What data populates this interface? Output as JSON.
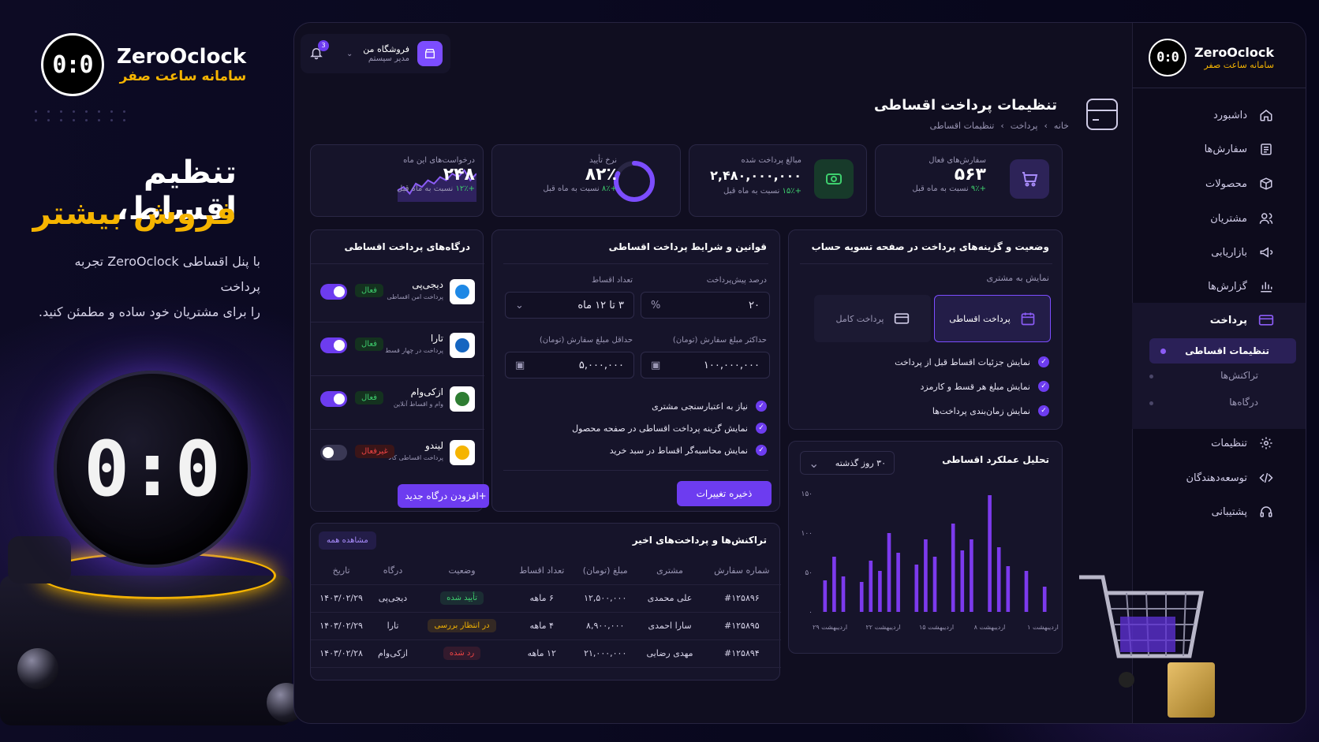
{
  "promo": {
    "brand_name": "ZeroOclock",
    "brand_sub": "سامانه ساعت صفر",
    "logo_text": "0:0",
    "hero_line1": "تنظیم اقساط،",
    "hero_line2": "فروش بیشتر",
    "desc_line1": "با پنل اقساطی ZeroOclock تجربه پرداخت",
    "desc_line2": "را برای مشتریان خود ساده و مطمئن کنید.",
    "coin_text": "0:0"
  },
  "topbar": {
    "notif_count": "3",
    "store_name": "فروشگاه من",
    "store_role": "مدیر سیستم"
  },
  "sidebar": {
    "brand_name": "ZeroOclock",
    "brand_sub": "سامانه ساعت صفر",
    "logo_text": "0:0",
    "items": [
      {
        "label": "داشبورد",
        "icon": "home-icon"
      },
      {
        "label": "سفارش‌ها",
        "icon": "orders-icon"
      },
      {
        "label": "محصولات",
        "icon": "box-icon"
      },
      {
        "label": "مشتریان",
        "icon": "users-icon"
      },
      {
        "label": "بازاریابی",
        "icon": "megaphone-icon"
      },
      {
        "label": "گزارش‌ها",
        "icon": "chart-icon"
      },
      {
        "label": "پرداخت",
        "icon": "card-icon"
      },
      {
        "label": "تنظیمات",
        "icon": "gear-icon"
      },
      {
        "label": "توسعه‌دهندگان",
        "icon": "code-icon"
      },
      {
        "label": "پشتیبانی",
        "icon": "headset-icon"
      }
    ],
    "sub_items": [
      "تنظیمات اقساطی",
      "تراکنش‌ها",
      "درگاه‌ها"
    ]
  },
  "header": {
    "title": "تنظیمات پرداخت اقساطی",
    "breadcrumb": [
      "خانه",
      "پرداخت",
      "تنظیمات اقساطی"
    ]
  },
  "stats": [
    {
      "label": "سفارش‌های فعال",
      "value": "۵۶۳",
      "delta": "+۹٪",
      "delta_label": "نسبت به ماه قبل"
    },
    {
      "label": "مبالغ پرداخت شده",
      "value": "۲,۴۸۰,۰۰۰,۰۰۰",
      "delta": "+۱۵٪",
      "delta_label": "نسبت به ماه قبل"
    },
    {
      "label": "نرخ تأیید",
      "value": "۸۲٪",
      "delta": "+۸٪",
      "delta_label": "نسبت به ماه قبل",
      "progress": 0.82
    },
    {
      "label": "درخواست‌های این ماه",
      "value": "۲۴۸",
      "delta": "+۱۲٪",
      "delta_label": "نسبت به ماه قبل",
      "spark": [
        3,
        4,
        2,
        5,
        4,
        6,
        5,
        7,
        6,
        8,
        7,
        9,
        6,
        8
      ]
    }
  ],
  "checkout": {
    "title": "وضعیت و گزینه‌های پرداخت در صفحه تسویه حساب",
    "show_label": "نمایش به مشتری",
    "option_installment": "پرداخت اقساطی",
    "option_full": "پرداخت کامل",
    "checks": [
      "نمایش جزئیات اقساط قبل از پرداخت",
      "نمایش مبلغ هر قسط و کارمزد",
      "نمایش زمان‌بندی پرداخت‌ها"
    ]
  },
  "rules": {
    "title": "قوانین و شرایط پرداخت اقساطی",
    "prepay_label": "درصد پیش‌پرداخت",
    "prepay_value": "۲۰",
    "prepay_unit": "%",
    "count_label": "تعداد اقساط",
    "count_value": "۳ تا ۱۲ ماه",
    "max_label": "حداکثر مبلغ سفارش (تومان)",
    "max_value": "۱۰۰,۰۰۰,۰۰۰",
    "min_label": "حداقل مبلغ سفارش (تومان)",
    "min_value": "۵,۰۰۰,۰۰۰",
    "checks": [
      "نیاز به اعتبارسنجی مشتری",
      "نمایش گزینه پرداخت اقساطی در صفحه محصول",
      "نمایش محاسبه‌گر اقساط در سبد خرید"
    ],
    "save_label": "ذخیره تغییرات"
  },
  "gateways": {
    "title": "درگاه‌های پرداخت اقساطی",
    "items": [
      {
        "name": "دیجی‌پی",
        "desc": "پرداخت امن اقساطی",
        "status": "فعال",
        "on": true,
        "color": "#1e88e5"
      },
      {
        "name": "تارا",
        "desc": "پرداخت در چهار قسط",
        "status": "فعال",
        "on": true,
        "color": "#1565c0"
      },
      {
        "name": "ازکی‌وام",
        "desc": "وام و اقساط آنلاین",
        "status": "فعال",
        "on": true,
        "color": "#2e7d32"
      },
      {
        "name": "لیندو",
        "desc": "پرداخت اقساطی کالا",
        "status": "غیرفعال",
        "on": false,
        "color": "#f5b400"
      }
    ],
    "add_label": "افزودن درگاه جدید"
  },
  "analysis": {
    "title": "تحلیل عملکرد اقساطی",
    "range": "۳۰ روز گذشته"
  },
  "chart_data": {
    "type": "bar",
    "title": "تحلیل عملکرد اقساطی",
    "yticks": [
      "۱۵۰",
      "۱۰۰",
      "۵۰",
      "۰"
    ],
    "ylim": [
      0,
      150
    ],
    "xticks": [
      "۱ اردیبهشت",
      "۸ اردیبهشت",
      "۱۵ اردیبهشت",
      "۲۲ اردیبهشت",
      "۲۹ اردیبهشت"
    ],
    "values": [
      40,
      70,
      45,
      0,
      38,
      65,
      52,
      100,
      75,
      0,
      60,
      92,
      70,
      0,
      112,
      78,
      92,
      0,
      148,
      82,
      58,
      0,
      52,
      0,
      32
    ]
  },
  "transactions": {
    "title": "تراکنش‌ها و پرداخت‌های اخیر",
    "view_all": "مشاهده همه",
    "headers": [
      "شماره سفارش",
      "مشتری",
      "مبلغ (تومان)",
      "تعداد اقساط",
      "وضعیت",
      "درگاه",
      "تاریخ"
    ],
    "rows": [
      {
        "id": "#۱۲۵۸۹۶",
        "customer": "علی محمدی",
        "amount": "۱۲,۵۰۰,۰۰۰",
        "count": "۶ ماهه",
        "status": "تأیید شده",
        "status_color": "#3ecf6e",
        "gateway": "دیجی‌پی",
        "date": "۱۴۰۳/۰۲/۲۹"
      },
      {
        "id": "#۱۲۵۸۹۵",
        "customer": "سارا احمدی",
        "amount": "۸,۹۰۰,۰۰۰",
        "count": "۴ ماهه",
        "status": "در انتظار بررسی",
        "status_color": "#f5b400",
        "gateway": "تارا",
        "date": "۱۴۰۳/۰۲/۲۹"
      },
      {
        "id": "#۱۲۵۸۹۴",
        "customer": "مهدی رضایی",
        "amount": "۲۱,۰۰۰,۰۰۰",
        "count": "۱۲ ماهه",
        "status": "رد شده",
        "status_color": "#ef4444",
        "gateway": "ازکی‌وام",
        "date": "۱۴۰۳/۰۲/۲۸"
      }
    ]
  },
  "colors": {
    "accent": "#6d3cf0",
    "gold": "#f5b400",
    "success": "#3ecf6e",
    "danger": "#ef4444"
  }
}
